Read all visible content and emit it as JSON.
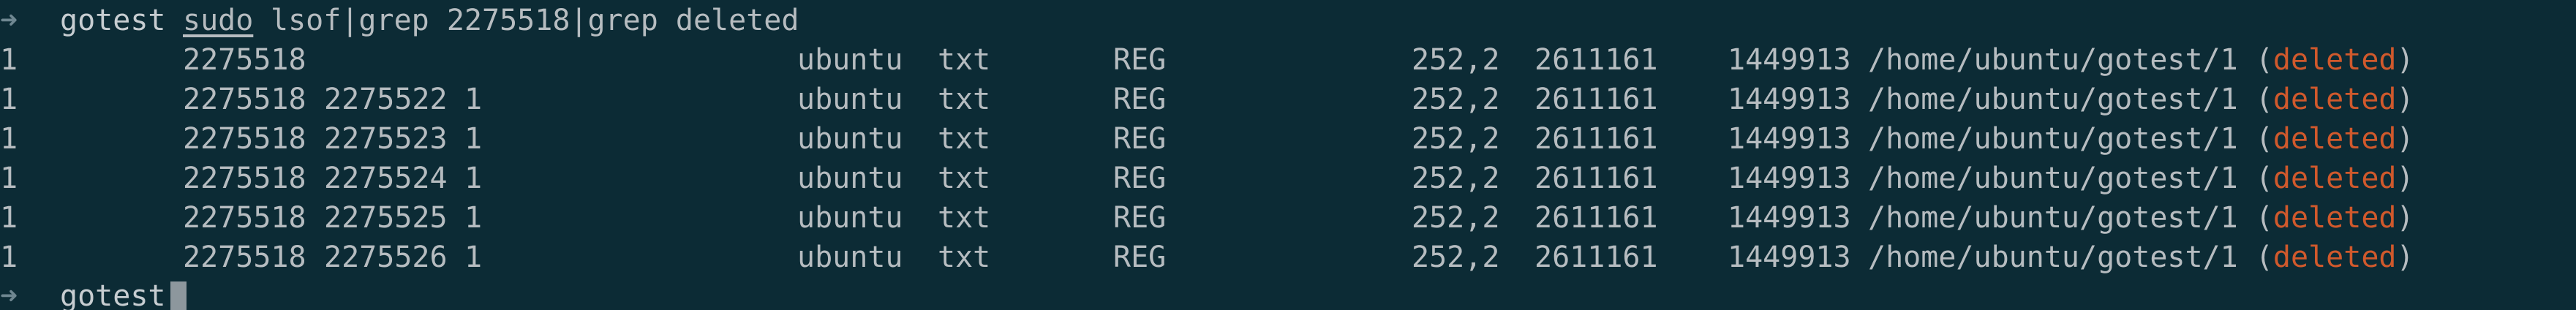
{
  "colors": {
    "background": "#0c2b35",
    "text": "#b6bcc0",
    "deleted": "#d0592c",
    "cursor": "#8d979d",
    "prompt": "#6f8791"
  },
  "prompt": {
    "arrow": "➜",
    "directory": "gotest"
  },
  "command": {
    "sudo": "sudo",
    "rest": "lsof|grep 2275518|grep deleted"
  },
  "rows": [
    {
      "c1": "1",
      "pid": "2275518",
      "tid": "",
      "tcmd": "",
      "user": "ubuntu",
      "fd": "txt",
      "type": "REG",
      "device": "252,2",
      "size": "2611161",
      "node": "1449913",
      "path": "/home/ubuntu/gotest/1",
      "open": "(",
      "status": "deleted",
      "close": ")"
    },
    {
      "c1": "1",
      "pid": "2275518",
      "tid": "2275522",
      "tcmd": "1",
      "user": "ubuntu",
      "fd": "txt",
      "type": "REG",
      "device": "252,2",
      "size": "2611161",
      "node": "1449913",
      "path": "/home/ubuntu/gotest/1",
      "open": "(",
      "status": "deleted",
      "close": ")"
    },
    {
      "c1": "1",
      "pid": "2275518",
      "tid": "2275523",
      "tcmd": "1",
      "user": "ubuntu",
      "fd": "txt",
      "type": "REG",
      "device": "252,2",
      "size": "2611161",
      "node": "1449913",
      "path": "/home/ubuntu/gotest/1",
      "open": "(",
      "status": "deleted",
      "close": ")"
    },
    {
      "c1": "1",
      "pid": "2275518",
      "tid": "2275524",
      "tcmd": "1",
      "user": "ubuntu",
      "fd": "txt",
      "type": "REG",
      "device": "252,2",
      "size": "2611161",
      "node": "1449913",
      "path": "/home/ubuntu/gotest/1",
      "open": "(",
      "status": "deleted",
      "close": ")"
    },
    {
      "c1": "1",
      "pid": "2275518",
      "tid": "2275525",
      "tcmd": "1",
      "user": "ubuntu",
      "fd": "txt",
      "type": "REG",
      "device": "252,2",
      "size": "2611161",
      "node": "1449913",
      "path": "/home/ubuntu/gotest/1",
      "open": "(",
      "status": "deleted",
      "close": ")"
    },
    {
      "c1": "1",
      "pid": "2275518",
      "tid": "2275526",
      "tcmd": "1",
      "user": "ubuntu",
      "fd": "txt",
      "type": "REG",
      "device": "252,2",
      "size": "2611161",
      "node": "1449913",
      "path": "/home/ubuntu/gotest/1",
      "open": "(",
      "status": "deleted",
      "close": ")"
    }
  ],
  "next_prompt": {
    "arrow": "➜",
    "directory": "gotest"
  }
}
